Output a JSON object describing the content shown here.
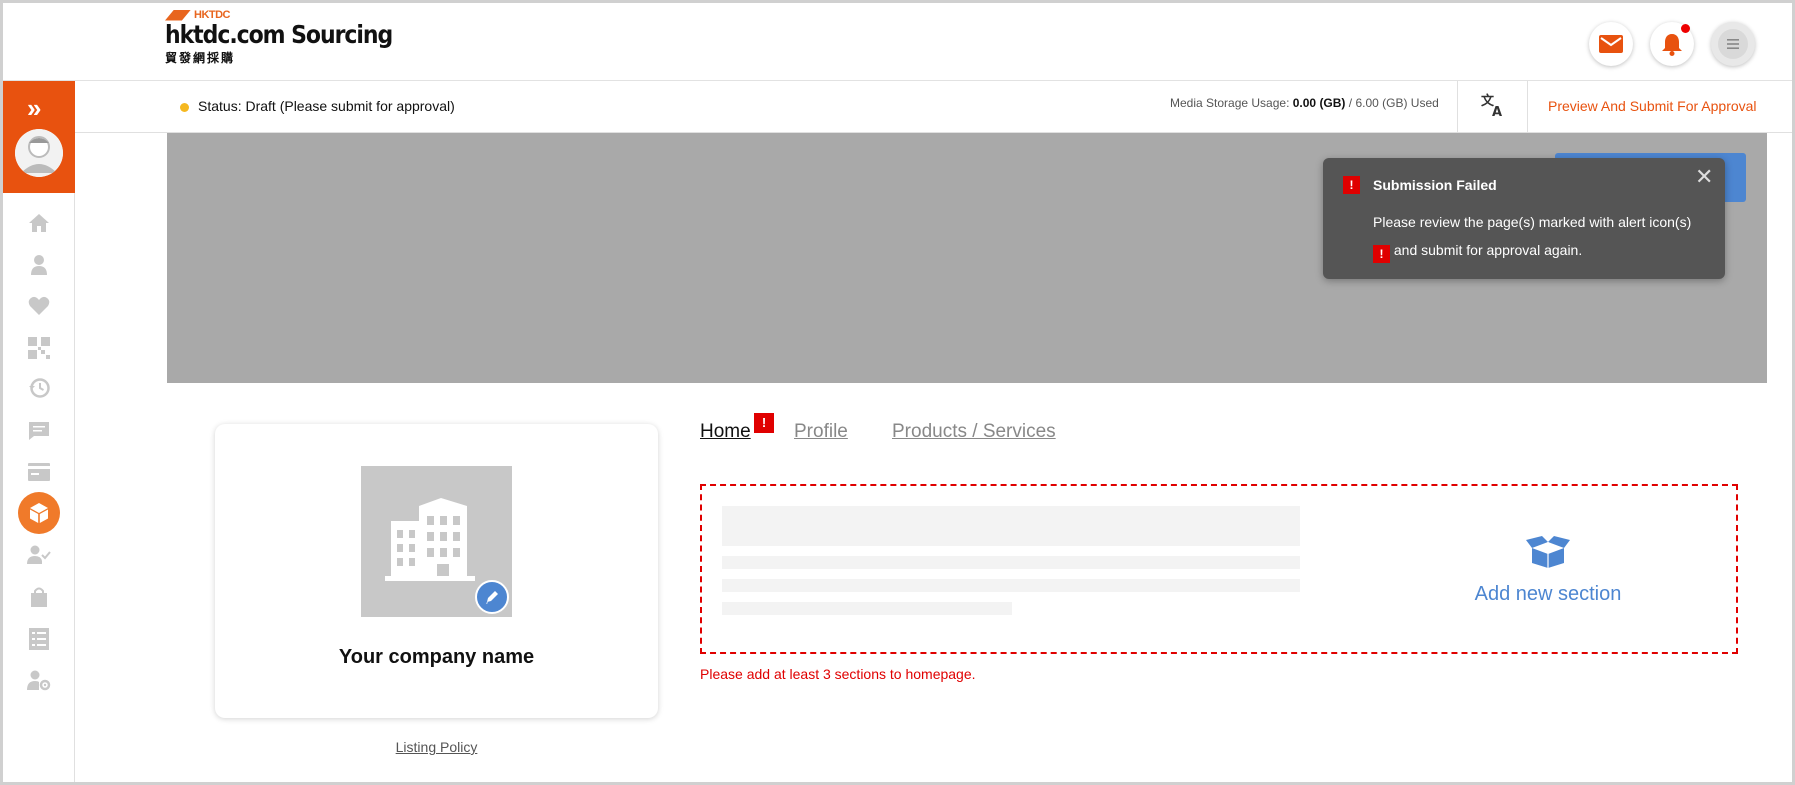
{
  "header": {
    "logo_small": "HKTDC",
    "logo_main": "hktdc.com Sourcing",
    "logo_sub": "貿發網採購",
    "icons": [
      "mail-icon",
      "bell-icon",
      "menu-icon"
    ]
  },
  "sidebar": {
    "items": [
      "home-icon",
      "user-icon",
      "heart-icon",
      "qr-code-icon",
      "history-icon",
      "message-icon",
      "card-icon",
      "package-icon",
      "user-check-icon",
      "bag-icon",
      "list-icon",
      "user-settings-icon"
    ],
    "active_item": "package-icon"
  },
  "statusbar": {
    "status_text": "Status: Draft (Please submit for approval)",
    "storage_label": "Media Storage Usage:",
    "storage_used": "0.00 (GB)",
    "storage_total": "/ 6.00 (GB) Used",
    "preview_link": "Preview And Submit For Approval"
  },
  "toast": {
    "title": "Submission Failed",
    "message_part1": "Please review the page(s) marked with alert icon(s)",
    "alert_glyph": "!",
    "message_part2": "and submit for approval again."
  },
  "company_card": {
    "name": "Your company name",
    "listing_policy": "Listing Policy"
  },
  "tabs": {
    "home": "Home",
    "profile": "Profile",
    "products": "Products / Services",
    "home_alert": "!"
  },
  "section": {
    "add_label": "Add new section",
    "error": "Please add at least 3 sections to homepage."
  },
  "colors": {
    "brand_orange": "#e8520f",
    "accent_blue": "#4d86d1",
    "alert_red": "#e00000",
    "status_yellow": "#f5b820"
  }
}
